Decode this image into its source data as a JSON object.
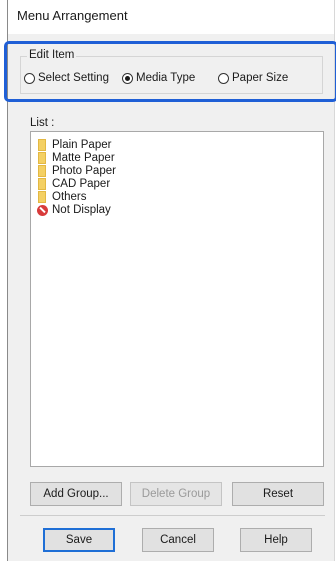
{
  "window": {
    "title": "Menu Arrangement"
  },
  "edit_item": {
    "legend": "Edit Item",
    "options": [
      {
        "label": "Select Setting",
        "checked": false
      },
      {
        "label": "Media Type",
        "checked": true
      },
      {
        "label": "Paper Size",
        "checked": false
      }
    ]
  },
  "list": {
    "label": "List :",
    "items": [
      {
        "label": "Plain Paper",
        "icon": "folder-icon"
      },
      {
        "label": "Matte Paper",
        "icon": "folder-icon"
      },
      {
        "label": "Photo Paper",
        "icon": "folder-icon"
      },
      {
        "label": "CAD Paper",
        "icon": "folder-icon"
      },
      {
        "label": "Others",
        "icon": "folder-icon"
      },
      {
        "label": "Not Display",
        "icon": "no-display-icon"
      }
    ]
  },
  "list_buttons": {
    "add_group": "Add Group...",
    "delete_group": "Delete Group",
    "reset": "Reset"
  },
  "footer_buttons": {
    "save": "Save",
    "cancel": "Cancel",
    "help": "Help"
  },
  "colors": {
    "highlight": "#1f5fd6",
    "folder": "#f4d063",
    "not_display": "#d83b3b"
  }
}
